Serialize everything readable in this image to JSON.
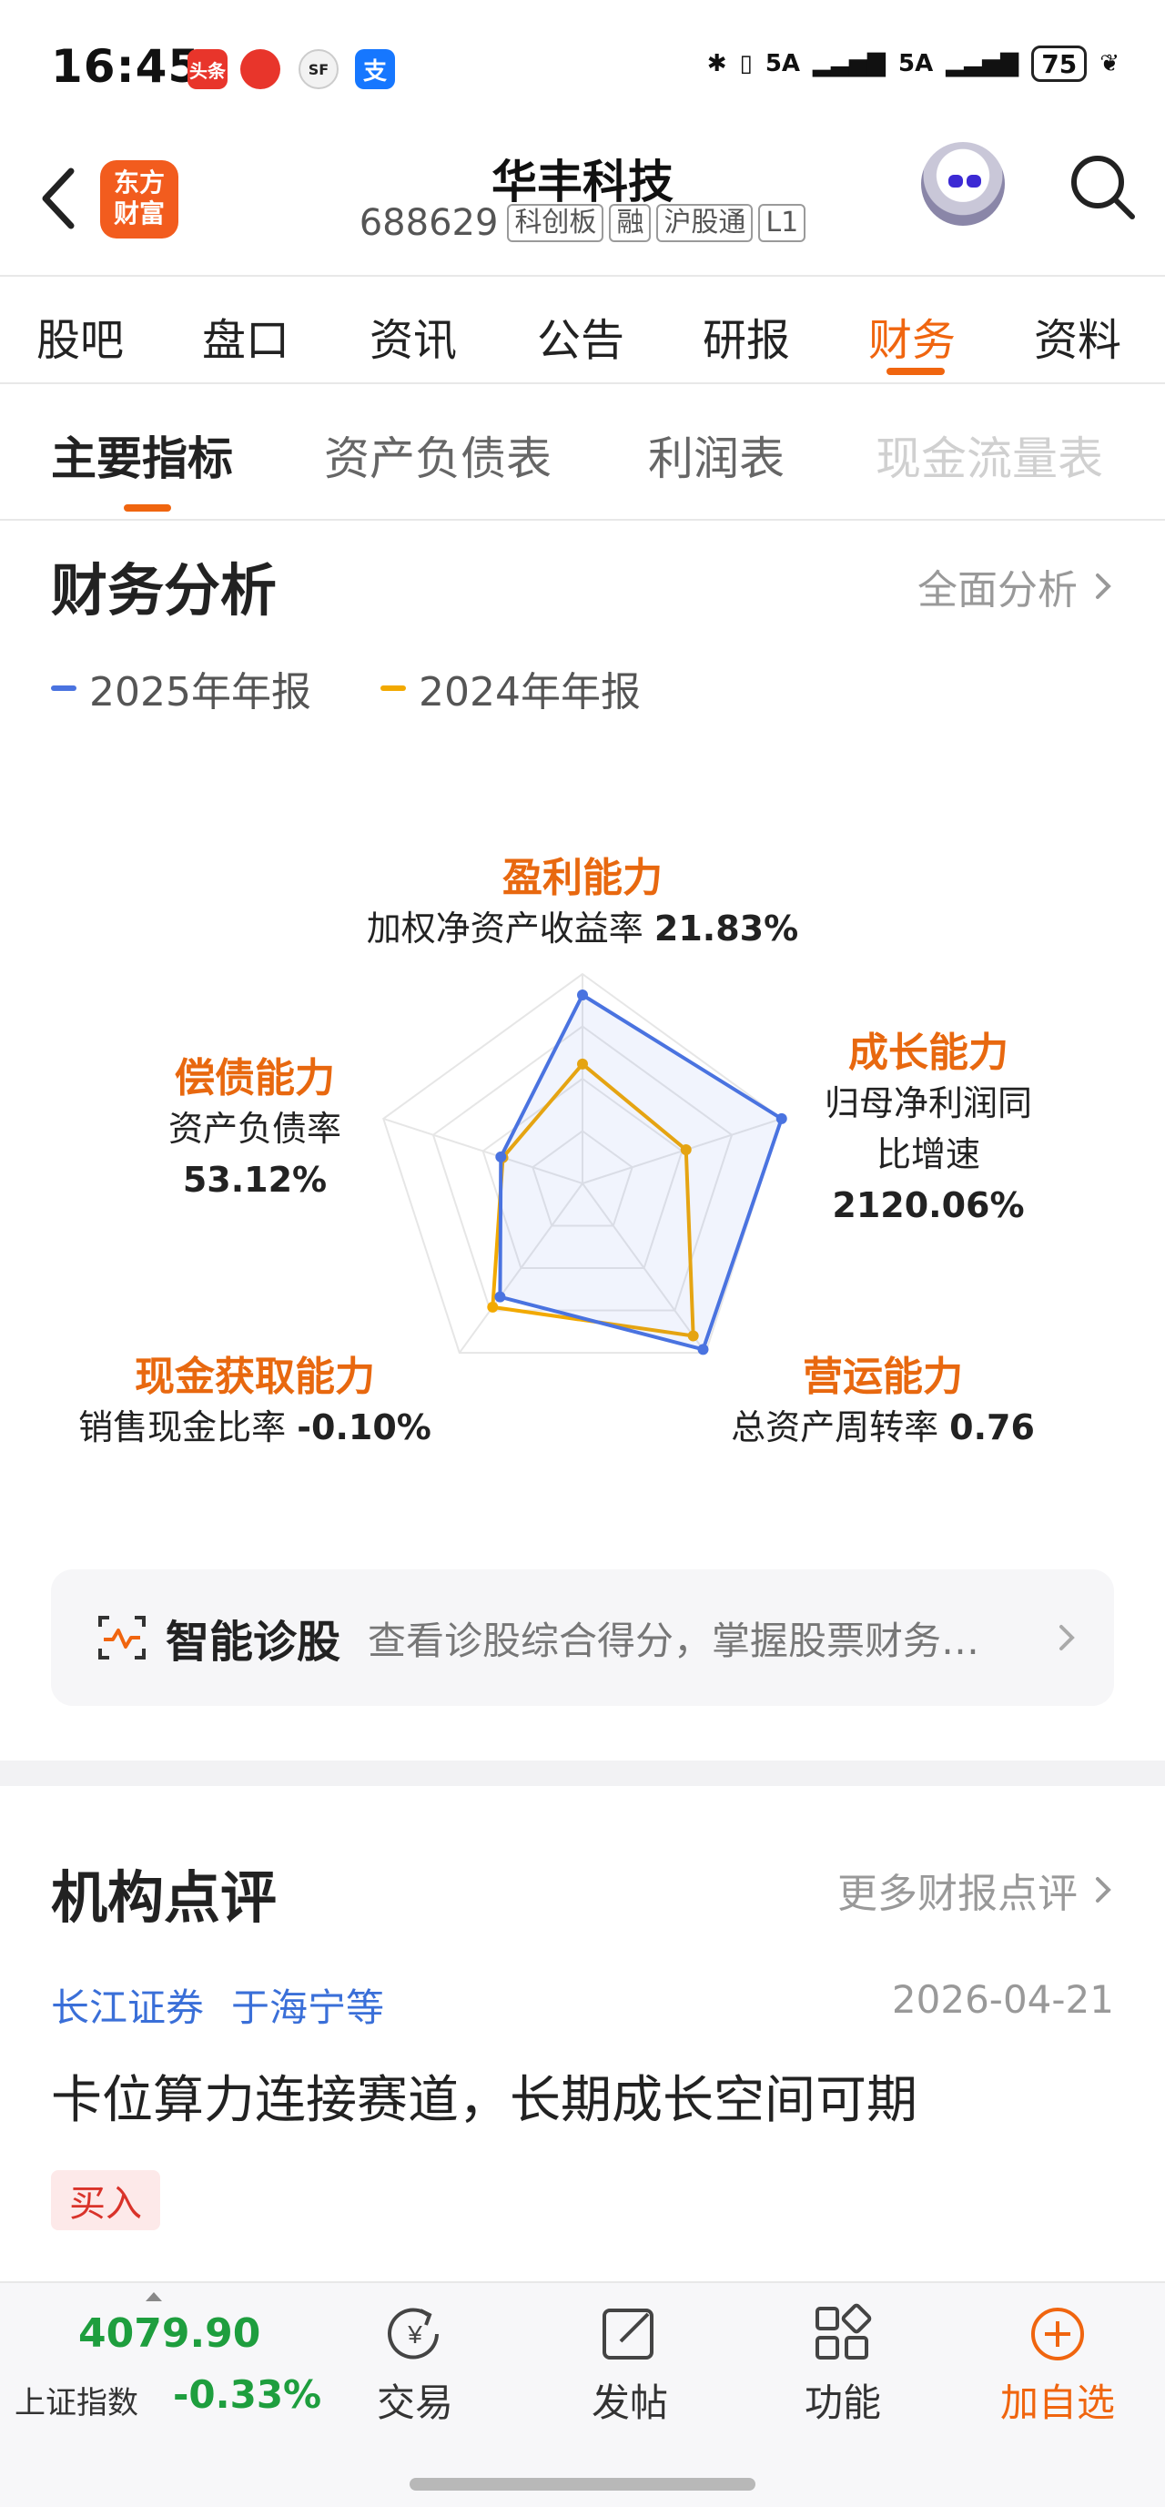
{
  "status_bar": {
    "time": "16:45",
    "apps": [
      "头条",
      "",
      "SF",
      "支"
    ],
    "network_1": "5A",
    "network_2": "5A",
    "battery": "75"
  },
  "header": {
    "logo_text": "东方\n财富",
    "stock_name": "华丰科技",
    "stock_code": "688629",
    "tags": [
      "科创板",
      "融",
      "沪股通",
      "L1"
    ]
  },
  "tabs": [
    "股吧",
    "盘口",
    "资讯",
    "公告",
    "研报",
    "财务",
    "资料"
  ],
  "active_tab": "财务",
  "subtabs": [
    "主要指标",
    "资产负债表",
    "利润表",
    "现金流量表"
  ],
  "active_subtab": "主要指标",
  "analysis": {
    "title": "财务分析",
    "link": "全面分析",
    "legend": [
      {
        "label": "2025年年报",
        "color": "#4a73e0"
      },
      {
        "label": "2024年年报",
        "color": "#f2a900"
      }
    ],
    "axes": [
      {
        "caption": "盈利能力",
        "metric": "加权净资产收益率",
        "value": "21.83%"
      },
      {
        "caption": "成长能力",
        "metric_line1": "归母净利润同",
        "metric_line2": "比增速",
        "value": "2120.06%"
      },
      {
        "caption": "营运能力",
        "metric": "总资产周转率",
        "value": "0.76"
      },
      {
        "caption": "现金获取能力",
        "metric": "销售现金比率",
        "value": "-0.10%"
      },
      {
        "caption": "偿债能力",
        "metric": "资产负债率",
        "value": "53.12%"
      }
    ],
    "radar_scores": {
      "series_2025": [
        0.9,
        1.0,
        0.98,
        0.67,
        0.41
      ],
      "series_2024": [
        0.57,
        0.52,
        0.9,
        0.73,
        0.4
      ]
    }
  },
  "diagnosis": {
    "title": "智能诊股",
    "desc": "查看诊股综合得分，掌握股票财务…"
  },
  "reviews": {
    "title": "机构点评",
    "link": "更多财报点评",
    "broker": "长江证券",
    "analyst": "于海宁等",
    "date": "2026-04-21",
    "headline": "卡位算力连接赛道，长期成长空间可期",
    "rating": "买入"
  },
  "bottom_bar": {
    "index_value": "4079.90",
    "index_name": "上证指数",
    "index_change": "-0.33%",
    "items": [
      "交易",
      "发帖",
      "功能",
      "加自选"
    ]
  }
}
